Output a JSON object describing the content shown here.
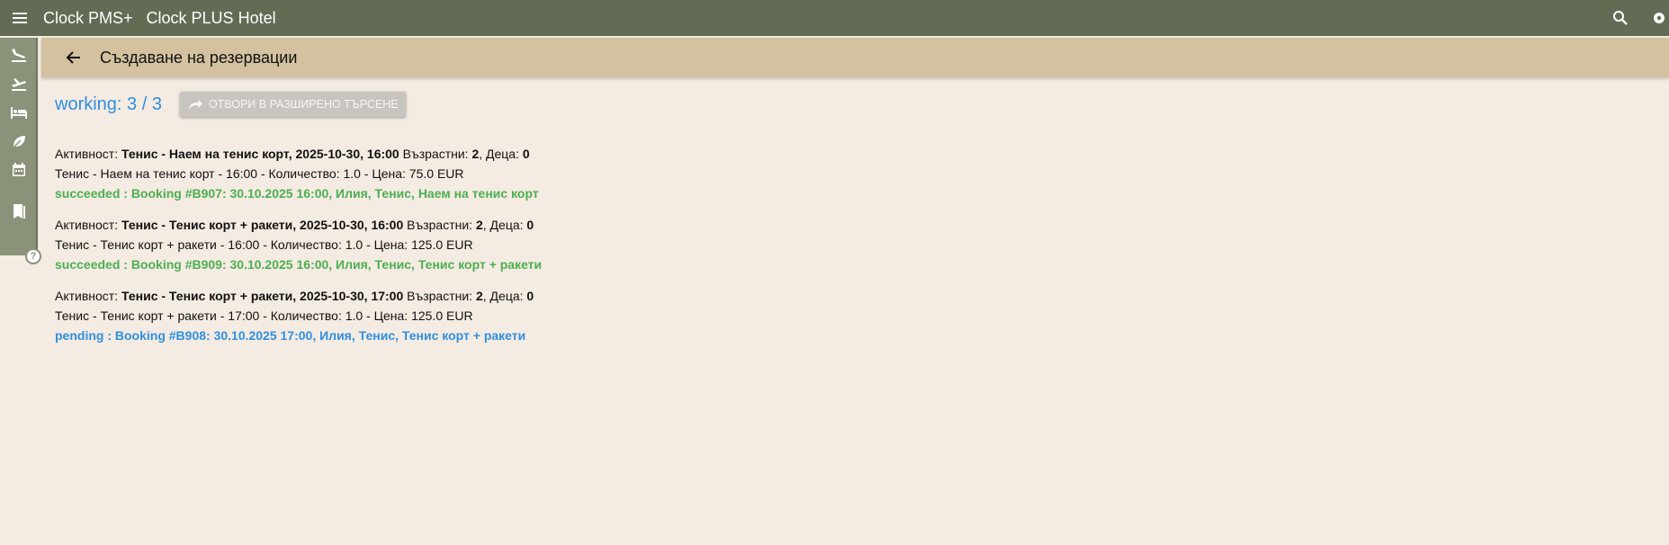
{
  "topbar": {
    "app_name": "Clock PMS+",
    "hotel_name": "Clock PLUS Hotel",
    "bg_color": "#636b55"
  },
  "rail": {
    "items": [
      {
        "icon": "flight-land-icon"
      },
      {
        "icon": "flight-takeoff-icon"
      },
      {
        "icon": "bed-icon"
      },
      {
        "icon": "leaf-icon"
      },
      {
        "icon": "calendar-icon"
      },
      {
        "icon": "book-icon"
      }
    ],
    "help_label": "?"
  },
  "subheader": {
    "title": "Създаване на резервации",
    "bg_color": "#d3c19f"
  },
  "status": {
    "working_text": "working: 3 / 3",
    "advanced_search_label": "ОТВОРИ В РАЗШИРЕНО ТЪРСЕНЕ"
  },
  "labels": {
    "activity": "Активност:",
    "adults": "Възрастни:",
    "children": "Деца:"
  },
  "entries": [
    {
      "activity": "Тенис - Наем на тенис корт, 2025-10-30, 16:00",
      "adults": "2",
      "children": "0",
      "detail": "Тенис - Наем на тенис корт - 16:00 - Количество: 1.0 - Цена: 75.0 EUR",
      "result": "succeeded : Booking #B907: 30.10.2025 16:00, Илия, Тенис, Наем на тенис корт",
      "state": "succeeded"
    },
    {
      "activity": "Тенис - Тенис корт + ракети, 2025-10-30, 16:00",
      "adults": "2",
      "children": "0",
      "detail": "Тенис - Тенис корт + ракети - 16:00 - Количество: 1.0 - Цена: 125.0 EUR",
      "result": "succeeded : Booking #B909: 30.10.2025 16:00, Илия, Тенис, Тенис корт + ракети",
      "state": "succeeded"
    },
    {
      "activity": "Тенис - Тенис корт + ракети, 2025-10-30, 17:00",
      "adults": "2",
      "children": "0",
      "detail": "Тенис - Тенис корт + ракети - 17:00 - Количество: 1.0 - Цена: 125.0 EUR",
      "result": "pending : Booking #B908: 30.10.2025 17:00, Илия, Тенис, Тенис корт + ракети",
      "state": "pending"
    }
  ],
  "colors": {
    "succeeded": "#4caf50",
    "pending": "#2f8fdf",
    "page_bg": "#f4ebe2"
  }
}
